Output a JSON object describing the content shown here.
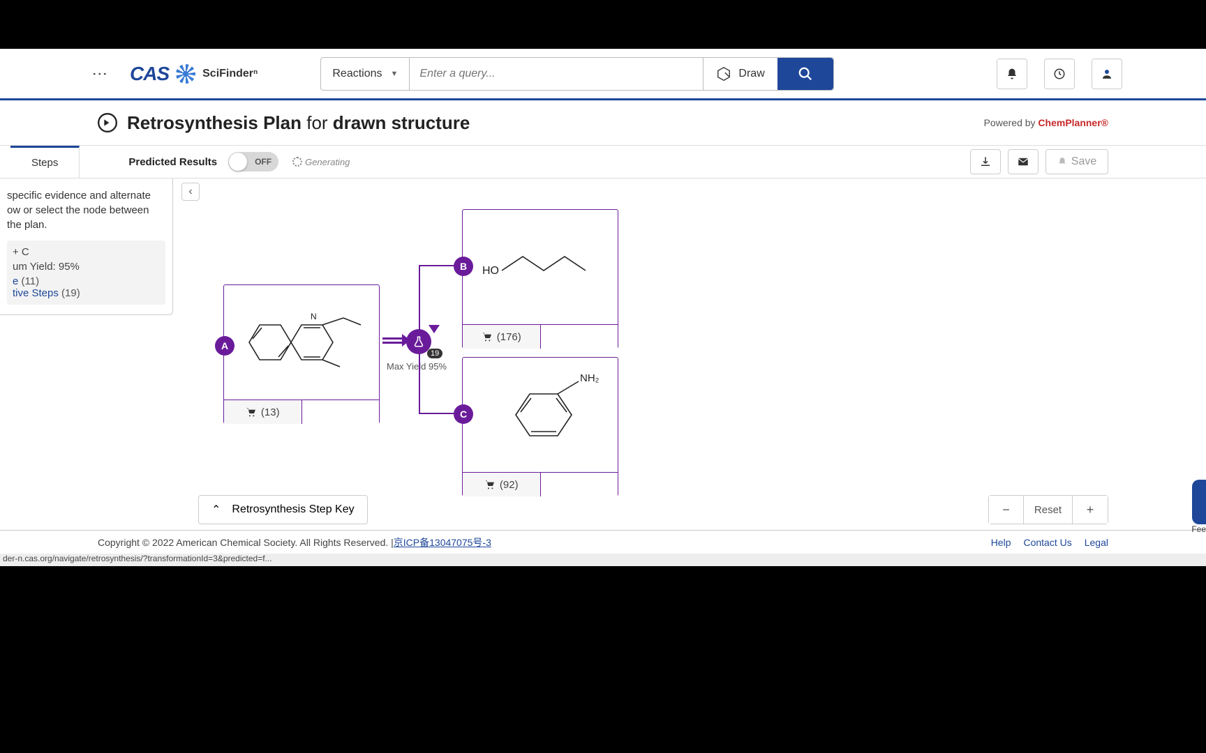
{
  "header": {
    "logo_primary": "CAS",
    "logo_secondary": "SciFinderⁿ",
    "search_type": "Reactions",
    "search_placeholder": "Enter a query...",
    "draw_label": "Draw"
  },
  "title": {
    "prefix": "Retrosynthesis Plan",
    "mid": "for",
    "subject": "drawn structure",
    "powered_prefix": "Powered by ",
    "powered_brand": "ChemPlanner®"
  },
  "toolbar": {
    "tab_steps": "Steps",
    "predicted_label": "Predicted Results",
    "toggle_state": "OFF",
    "generating": "Generating",
    "save_label": "Save"
  },
  "side": {
    "hint_l1": "specific evidence and alternate",
    "hint_l2": "ow or select the node between",
    "hint_l3": "the plan.",
    "step_title": "+ C",
    "yield_line": "um Yield: 95%",
    "evidence_link": "e ",
    "evidence_count": "(11)",
    "alt_link": "tive Steps ",
    "alt_count": "(19)"
  },
  "diagram": {
    "node_a": "A",
    "node_b": "B",
    "node_c": "C",
    "rxn_count": "19",
    "max_yield": "Max Yield 95%",
    "mol_a_label": "HO",
    "mol_c_label": "NH₂",
    "sup_a": "(13)",
    "sup_b": "(176)",
    "sup_c": "(92)",
    "step_key": "Retrosynthesis Step Key",
    "reset": "Reset",
    "feedback": "Fee"
  },
  "footer": {
    "copyright": "Copyright © 2022 American Chemical Society. All Rights Reserved. | ",
    "icp": "京ICP备13047075号-3",
    "help": "Help",
    "contact": "Contact Us",
    "legal": "Legal",
    "status_url": "der-n.cas.org/navigate/retrosynthesis/?transformationId=3&predicted=f..."
  }
}
